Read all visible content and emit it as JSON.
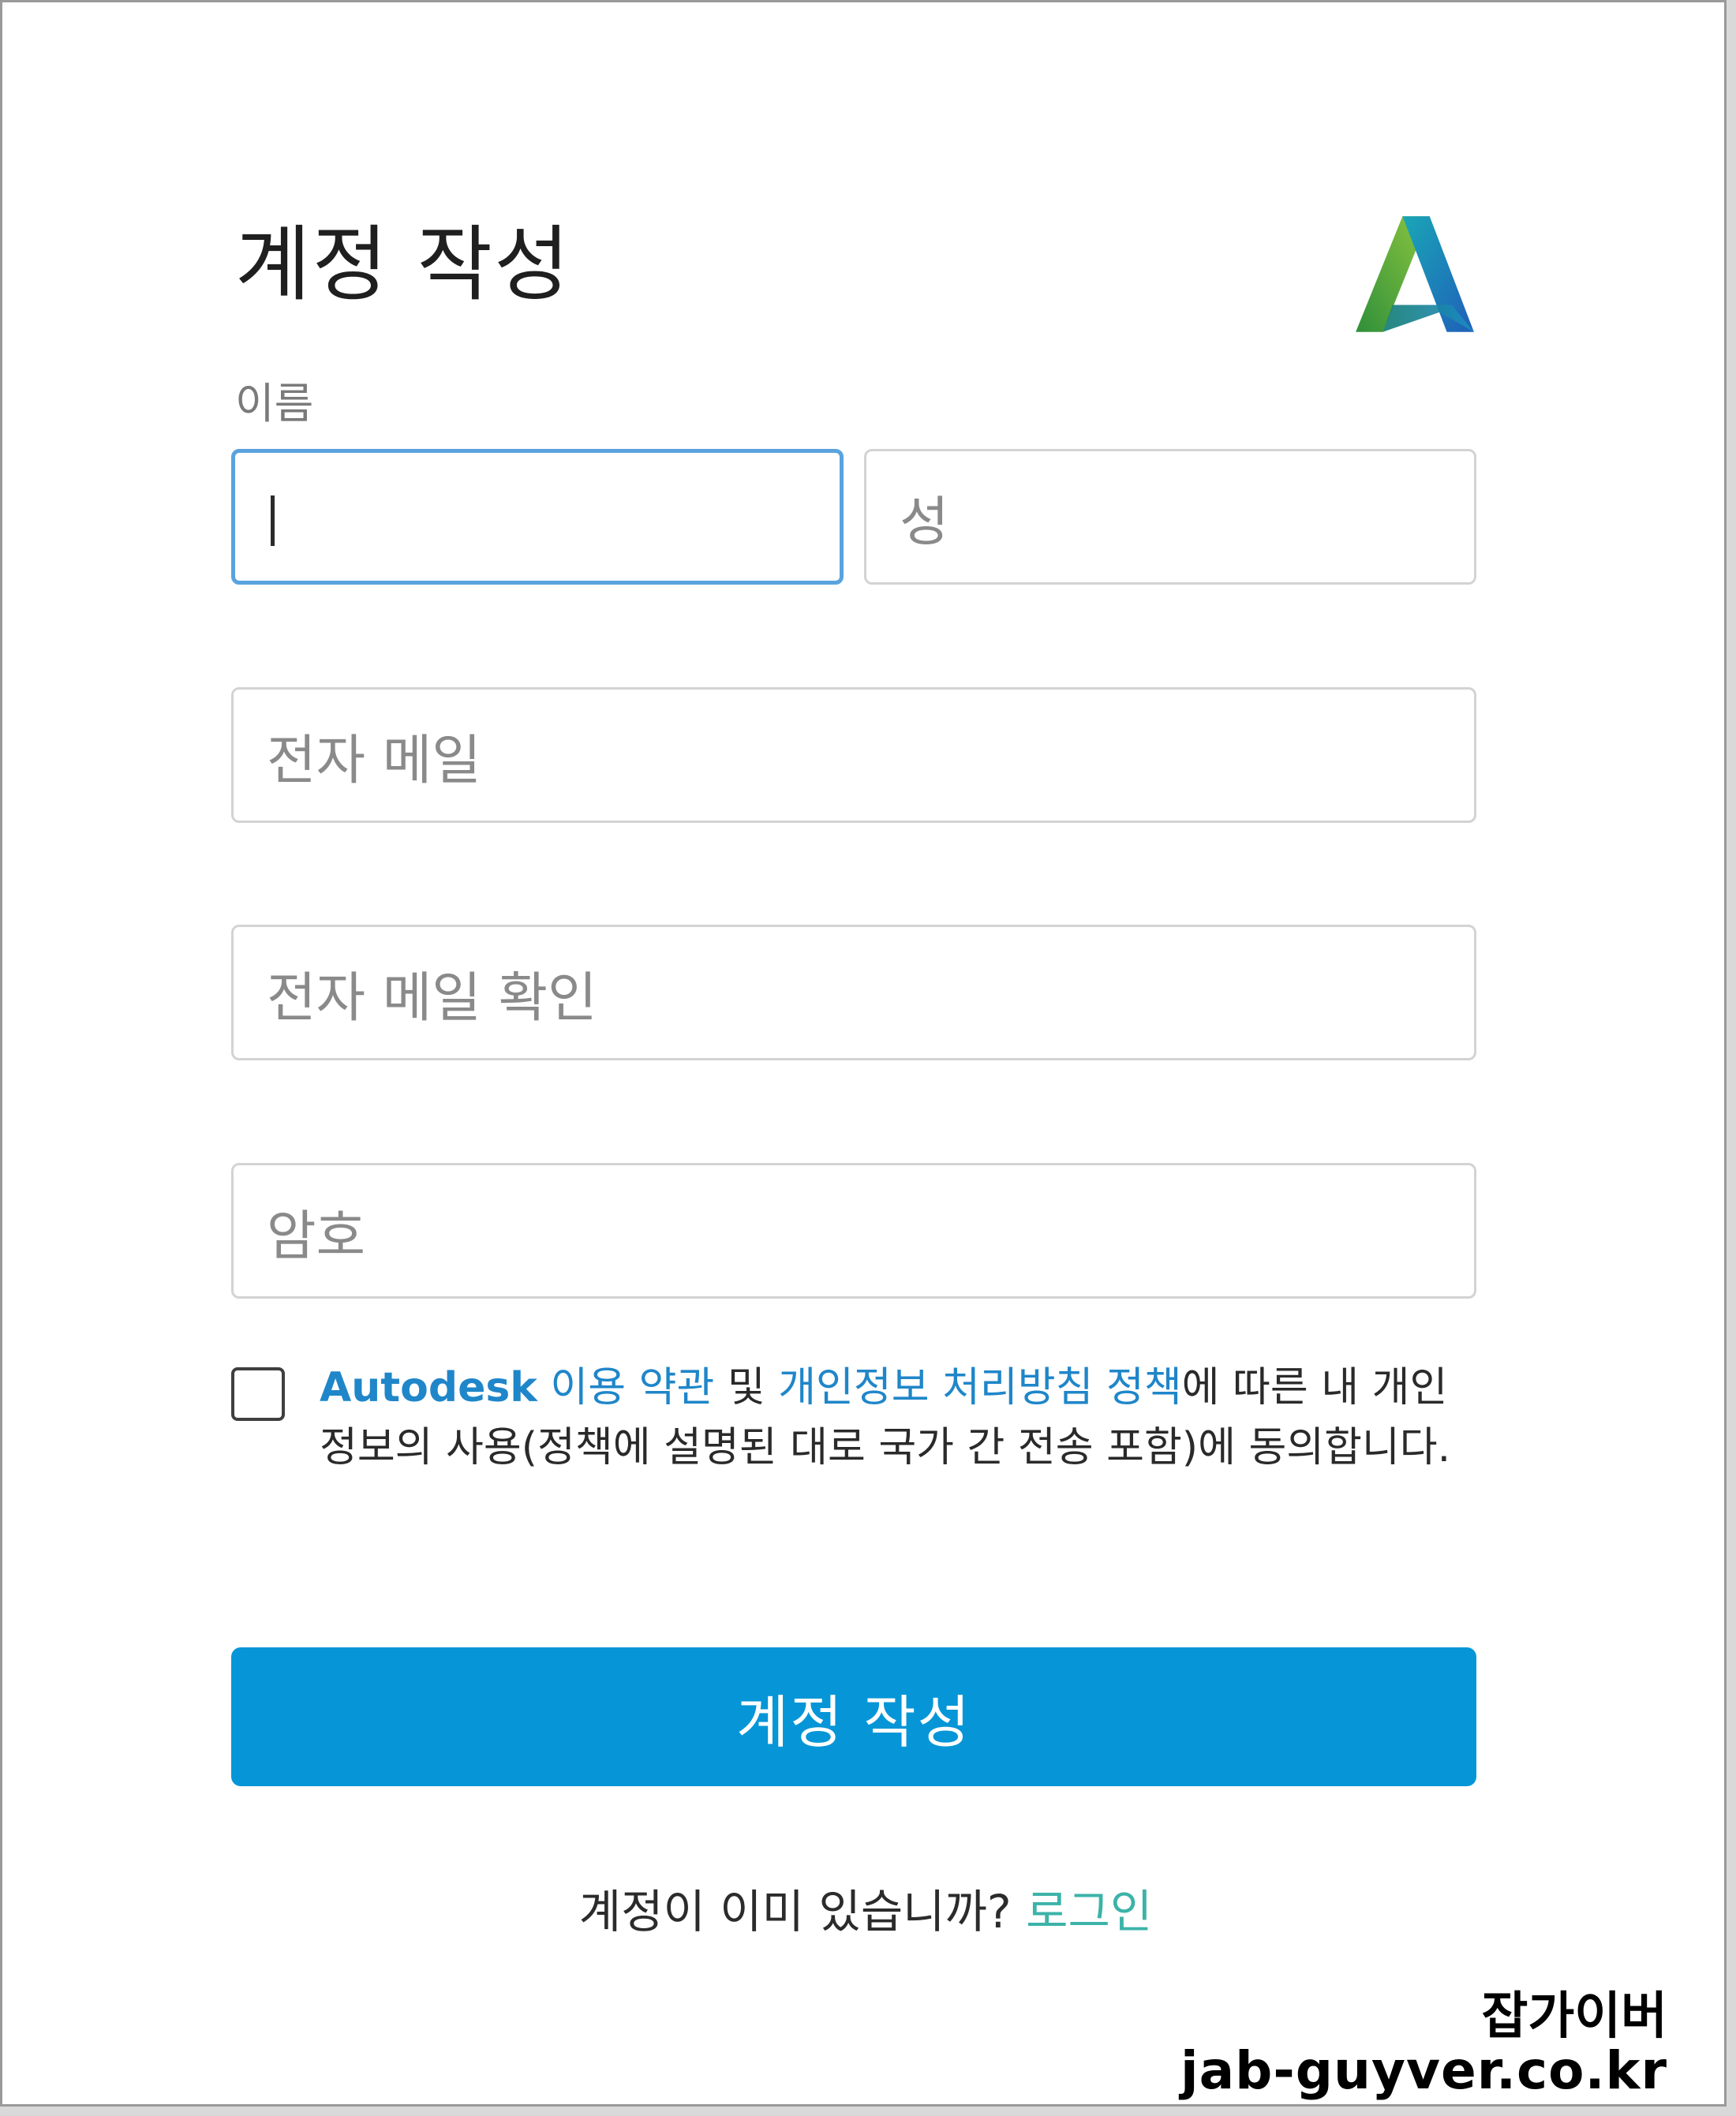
{
  "form": {
    "title": "계정 작성",
    "name_label": "이름",
    "first_name": {
      "value": "",
      "placeholder": ""
    },
    "last_name": {
      "value": "",
      "placeholder": "성"
    },
    "email": {
      "value": "",
      "placeholder": "전자 메일"
    },
    "email_confirm": {
      "value": "",
      "placeholder": "전자 메일 확인"
    },
    "password": {
      "value": "",
      "placeholder": "암호"
    }
  },
  "consent": {
    "checked": false,
    "brand": "Autodesk",
    "terms_link": " 이용 약관",
    "and": " 및 ",
    "privacy_link": "개인정보 처리방침 정책",
    "rest": "에 따른 내 개인 정보의 사용(정책에 설명된 대로 국가 간 전송 포함)에 동의합니다."
  },
  "submit_label": "계정 작성",
  "footer": {
    "question": "계정이 이미 있습니까? ",
    "login_link": "로그인"
  },
  "watermark": {
    "name": "잡가이버",
    "url": "jab-guyver.co.kr"
  },
  "colors": {
    "primary_button": "#0696d7",
    "link": "#1f86c9",
    "login_link": "#3cb3a8",
    "focus_border": "#5aa3de"
  },
  "icons": {
    "logo": "autodesk-logo-icon"
  }
}
